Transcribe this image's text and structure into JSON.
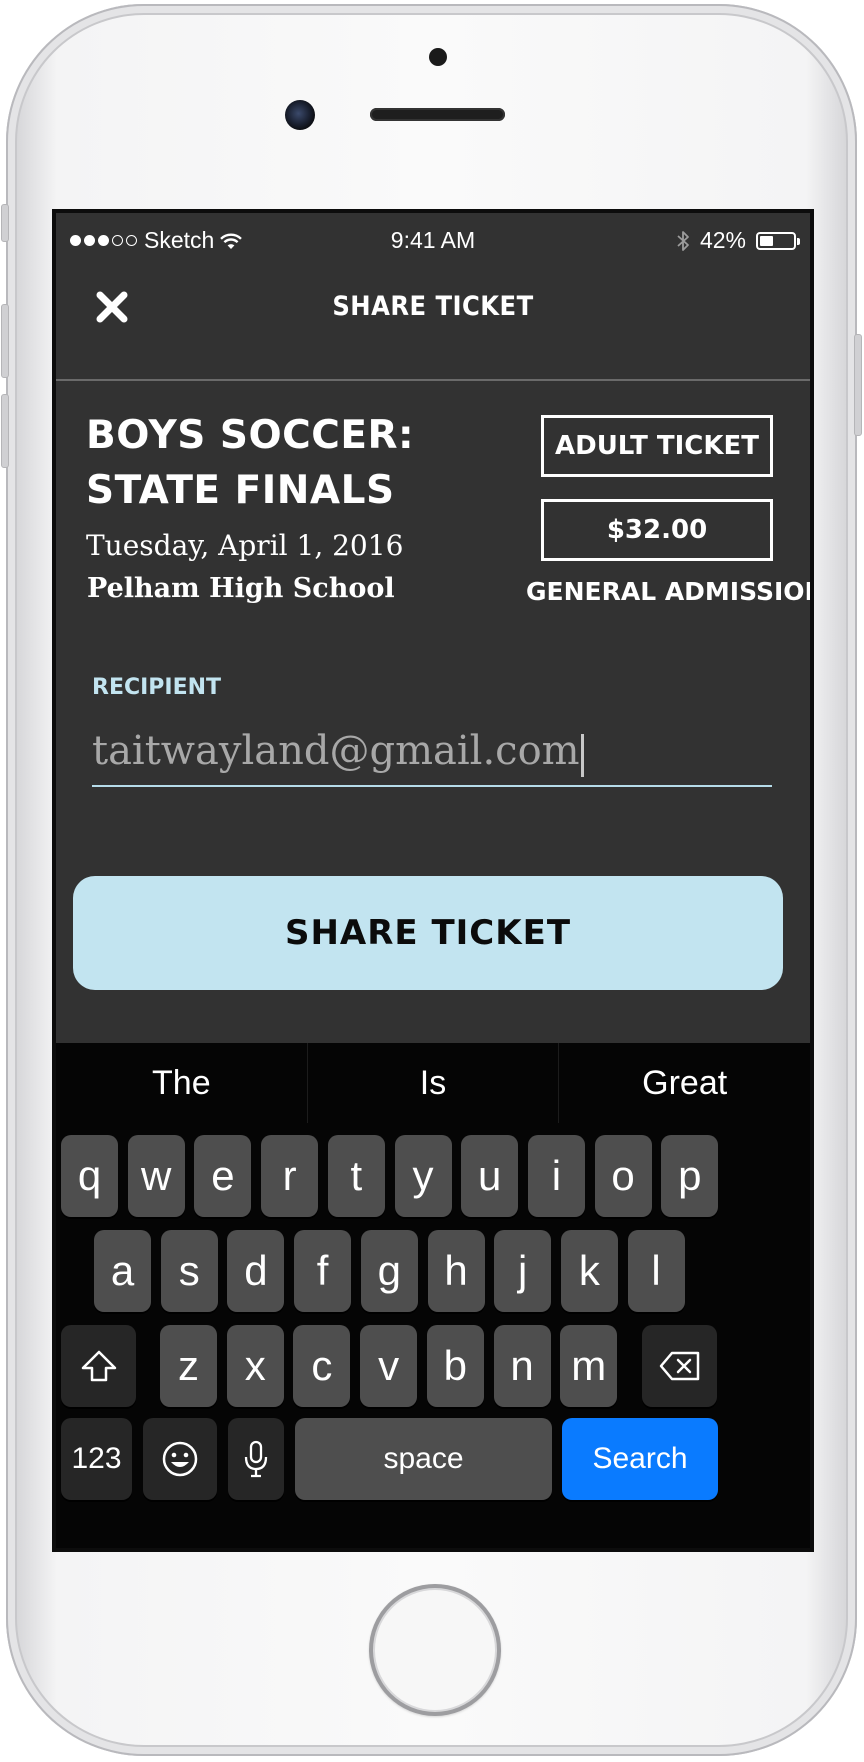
{
  "status_bar": {
    "carrier": "Sketch",
    "time": "9:41 AM",
    "battery": "42%",
    "battery_level": 0.42
  },
  "nav": {
    "title": "SHARE TICKET",
    "close_icon": "close-icon"
  },
  "event": {
    "title": "BOYS SOCCER: STATE FINALS",
    "date": "Tuesday, April 1, 2016",
    "venue": "Pelham High School"
  },
  "ticket": {
    "type": "ADULT TICKET",
    "price": "$32.00",
    "admission": "GENERAL ADMISSION"
  },
  "recipient": {
    "label": "RECIPIENT",
    "value": "taitwayland@gmail.com"
  },
  "share_button": {
    "label": "SHARE TICKET"
  },
  "keyboard": {
    "suggestions": [
      "The",
      "Is",
      "Great"
    ],
    "row1": [
      "q",
      "w",
      "e",
      "r",
      "t",
      "y",
      "u",
      "i",
      "o",
      "p"
    ],
    "row2": [
      "a",
      "s",
      "d",
      "f",
      "g",
      "h",
      "j",
      "k",
      "l"
    ],
    "row3": [
      "z",
      "x",
      "c",
      "v",
      "b",
      "n",
      "m"
    ],
    "numbers_label": "123",
    "space_label": "space",
    "search_label": "Search",
    "colors": {
      "search": "#0a7bff",
      "key": "#4e4e4e"
    }
  },
  "colors": {
    "accent": "#c2e4f0",
    "screen_bg": "#323232"
  }
}
